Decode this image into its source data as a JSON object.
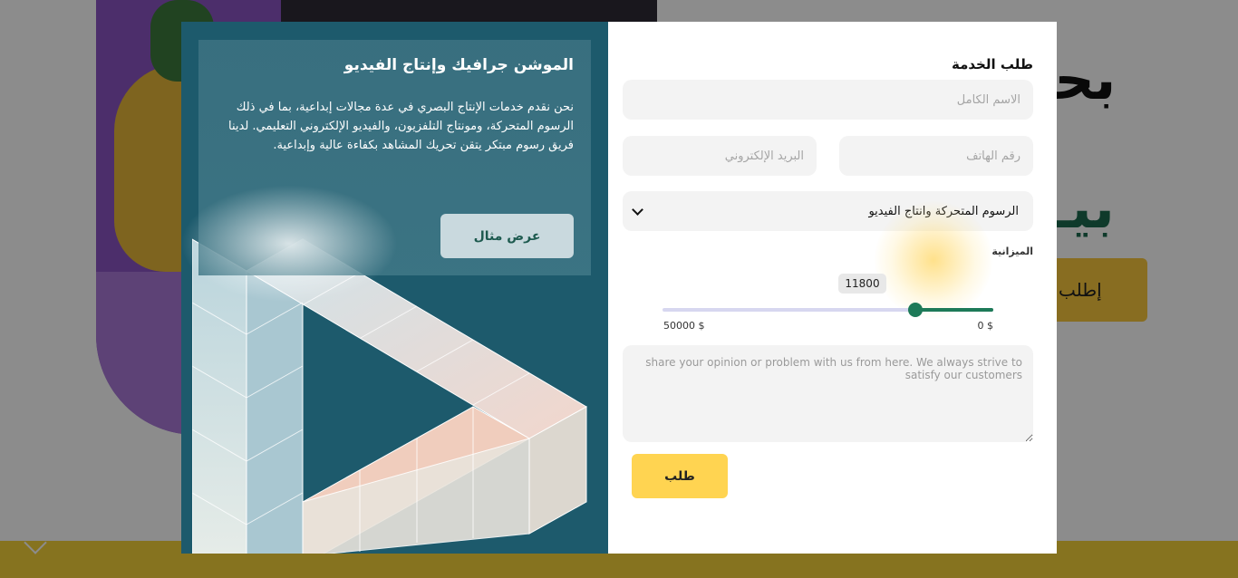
{
  "background": {
    "heading_line": "بحا",
    "heading_green": "بيـ",
    "cta_label": "إطلب"
  },
  "info": {
    "title": "الموشن جرافيك وإنتاج الفيديو",
    "text": "نحن نقدم خدمات الإنتاج البصري في عدة مجالات إبداعية، بما في ذلك الرسوم المتحركة، ومونتاج التلفزيون، والفيديو الإلكتروني التعليمي. لدينا فريق رسوم مبتكر يتقن تحريك المشاهد بكفاءة عالية وإبداعية.",
    "example_button": "عرض مثال"
  },
  "form": {
    "title": "طلب الخدمة",
    "name_placeholder": "الاسم الكامل",
    "phone_placeholder": "رقم الهاتف",
    "email_placeholder": "البريد الإلكتروني",
    "service_selected": "الرسوم المتحركة وانتاج الفيديو",
    "budget_label": "الميزانية",
    "budget_value": "11800",
    "budget_min_label": "0 $",
    "budget_max_label": "50000 $",
    "budget_fraction": 0.236,
    "message_placeholder": "share your opinion or problem with us from here. We always strive to satisfy our customers",
    "submit_label": "طلب"
  },
  "colors": {
    "panel": "#1d5a6c",
    "accent_green": "#1d7a58",
    "accent_yellow": "#ffd451"
  }
}
